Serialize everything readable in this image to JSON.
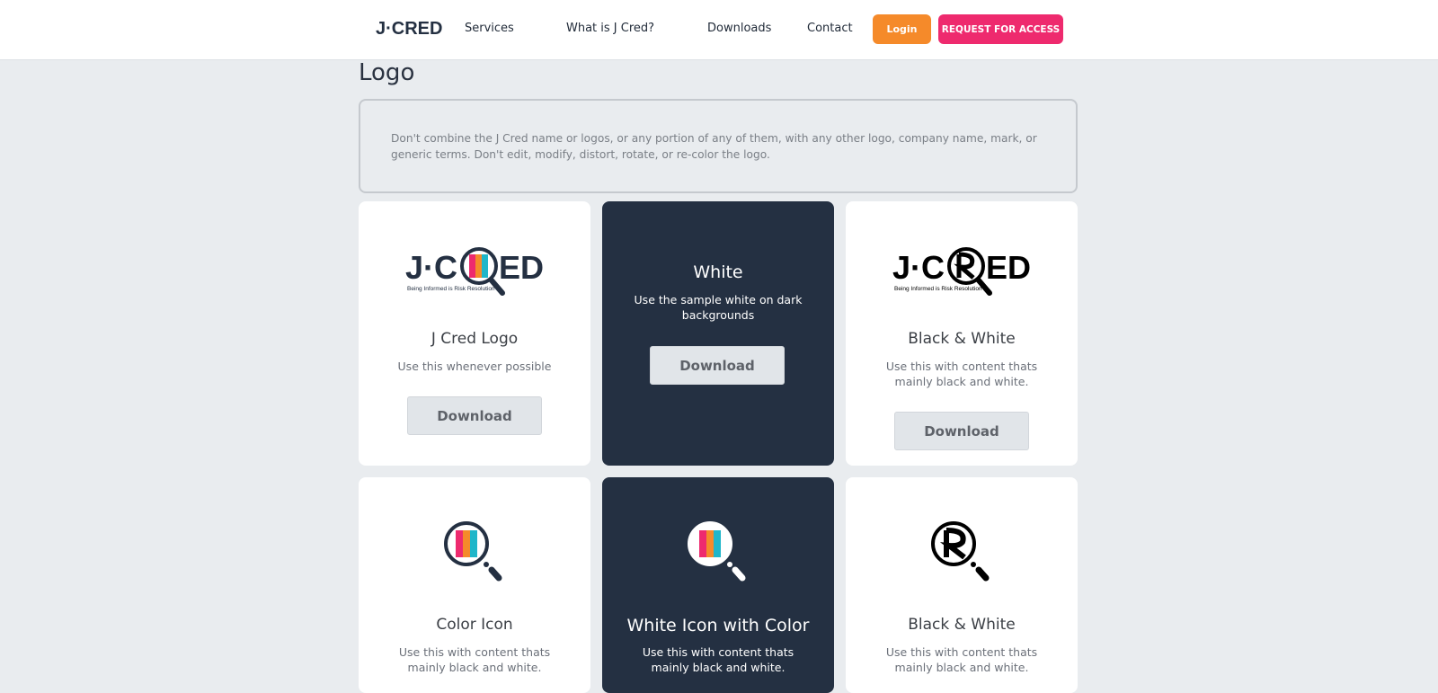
{
  "header": {
    "brand": "J·CRED",
    "nav": [
      "Services",
      "What is J Cred?",
      "Downloads",
      "Contact"
    ],
    "login_label": "Login",
    "access_label": "REQUEST FOR ACCESS"
  },
  "page": {
    "title": "Logo",
    "notice": "Don't combine the J Cred name or logos, or any portion of any of them, with any other logo, company name, mark, or generic terms. Don't edit, modify, distort, rotate, or re-color the logo."
  },
  "cards": [
    {
      "title": "J Cred Logo",
      "desc": "Use this whenever possible",
      "button": "Download",
      "tagline": "Being Informed is Risk Resolution"
    },
    {
      "title": "White",
      "desc": "Use the sample white on dark backgrounds",
      "button": "Download"
    },
    {
      "title": "Black & White",
      "desc": "Use this with content thats mainly black and white.",
      "button": "Download",
      "tagline": "Being Informed is Risk Resolution"
    },
    {
      "title": "Color Icon",
      "desc": "Use this with content thats mainly black and white."
    },
    {
      "title": "White Icon with Color",
      "desc": "Use this with content thats mainly black and white."
    },
    {
      "title": "Black & White",
      "desc": "Use this with content thats mainly black and white."
    }
  ],
  "colors": {
    "navy": "#243042",
    "orange": "#f58a2a",
    "pink": "#ee2a6e",
    "teal": "#1fb6c9",
    "page_bg": "#e9ecef"
  }
}
